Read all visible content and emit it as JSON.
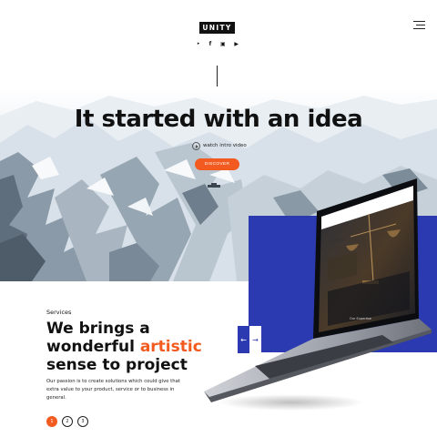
{
  "header": {
    "logo": "UNITY",
    "social_icons": [
      "twitter-icon",
      "facebook-icon",
      "instagram-icon",
      "youtube-icon"
    ],
    "social_glyphs": [
      "‣",
      "f",
      "▣",
      "▶"
    ],
    "menu_icon": "hamburger-icon"
  },
  "hero": {
    "title": "It started with an idea",
    "watch_label": "watch intro video",
    "cta_label": "DISCOVER"
  },
  "laptop_screen": {
    "nav_logo": "LNTY",
    "caption": "Our Expertise"
  },
  "services": {
    "label": "Services",
    "heading_line1": "We brings a",
    "heading_line2_pre": "wonderful ",
    "heading_line2_accent": "artistic",
    "heading_line3": "sense to project",
    "body": "Our passion is to create solutions which could give that extra value to your product, service or to business in general.",
    "pager": [
      {
        "label": "1",
        "active": true
      },
      {
        "label": "2",
        "active": false
      },
      {
        "label": "3",
        "active": false
      }
    ],
    "arrow_prev": "←",
    "arrow_next": "→"
  },
  "colors": {
    "accent": "#f25a1f",
    "blue": "#2b3ab1",
    "dark": "#111111"
  }
}
